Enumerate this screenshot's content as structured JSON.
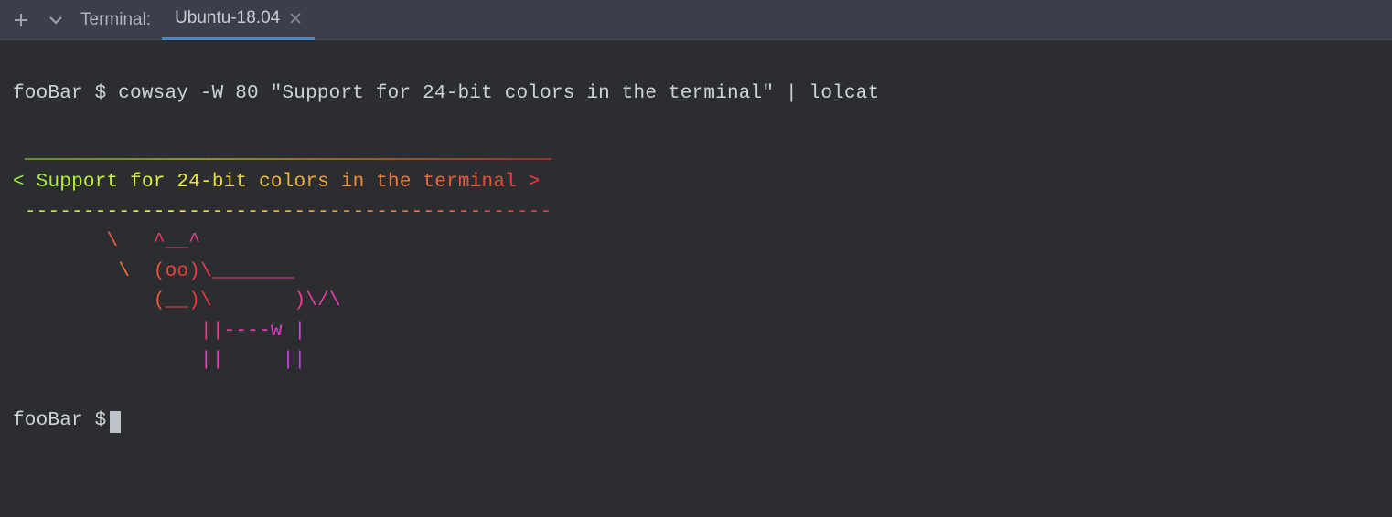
{
  "titlebar": {
    "label": "Terminal:",
    "tab_label": "Ubuntu-18.04"
  },
  "terminal": {
    "prompt": "fooBar $",
    "command": "cowsay -W 80 \"Support for 24-bit colors in the terminal\" | lolcat",
    "cowsay_lines": [
      " _____________________________________________ ",
      "< Support for 24-bit colors in the terminal >",
      " --------------------------------------------- ",
      "        \\   ^__^",
      "         \\  (oo)\\_______",
      "            (__)\\       )\\/\\",
      "                ||----w |",
      "                ||     ||"
    ],
    "gradient_rows_hue_start": [
      90,
      88,
      85,
      60,
      55,
      50,
      35,
      20
    ],
    "gradient_row_hue_span": 90,
    "final_prompt": "fooBar $"
  }
}
